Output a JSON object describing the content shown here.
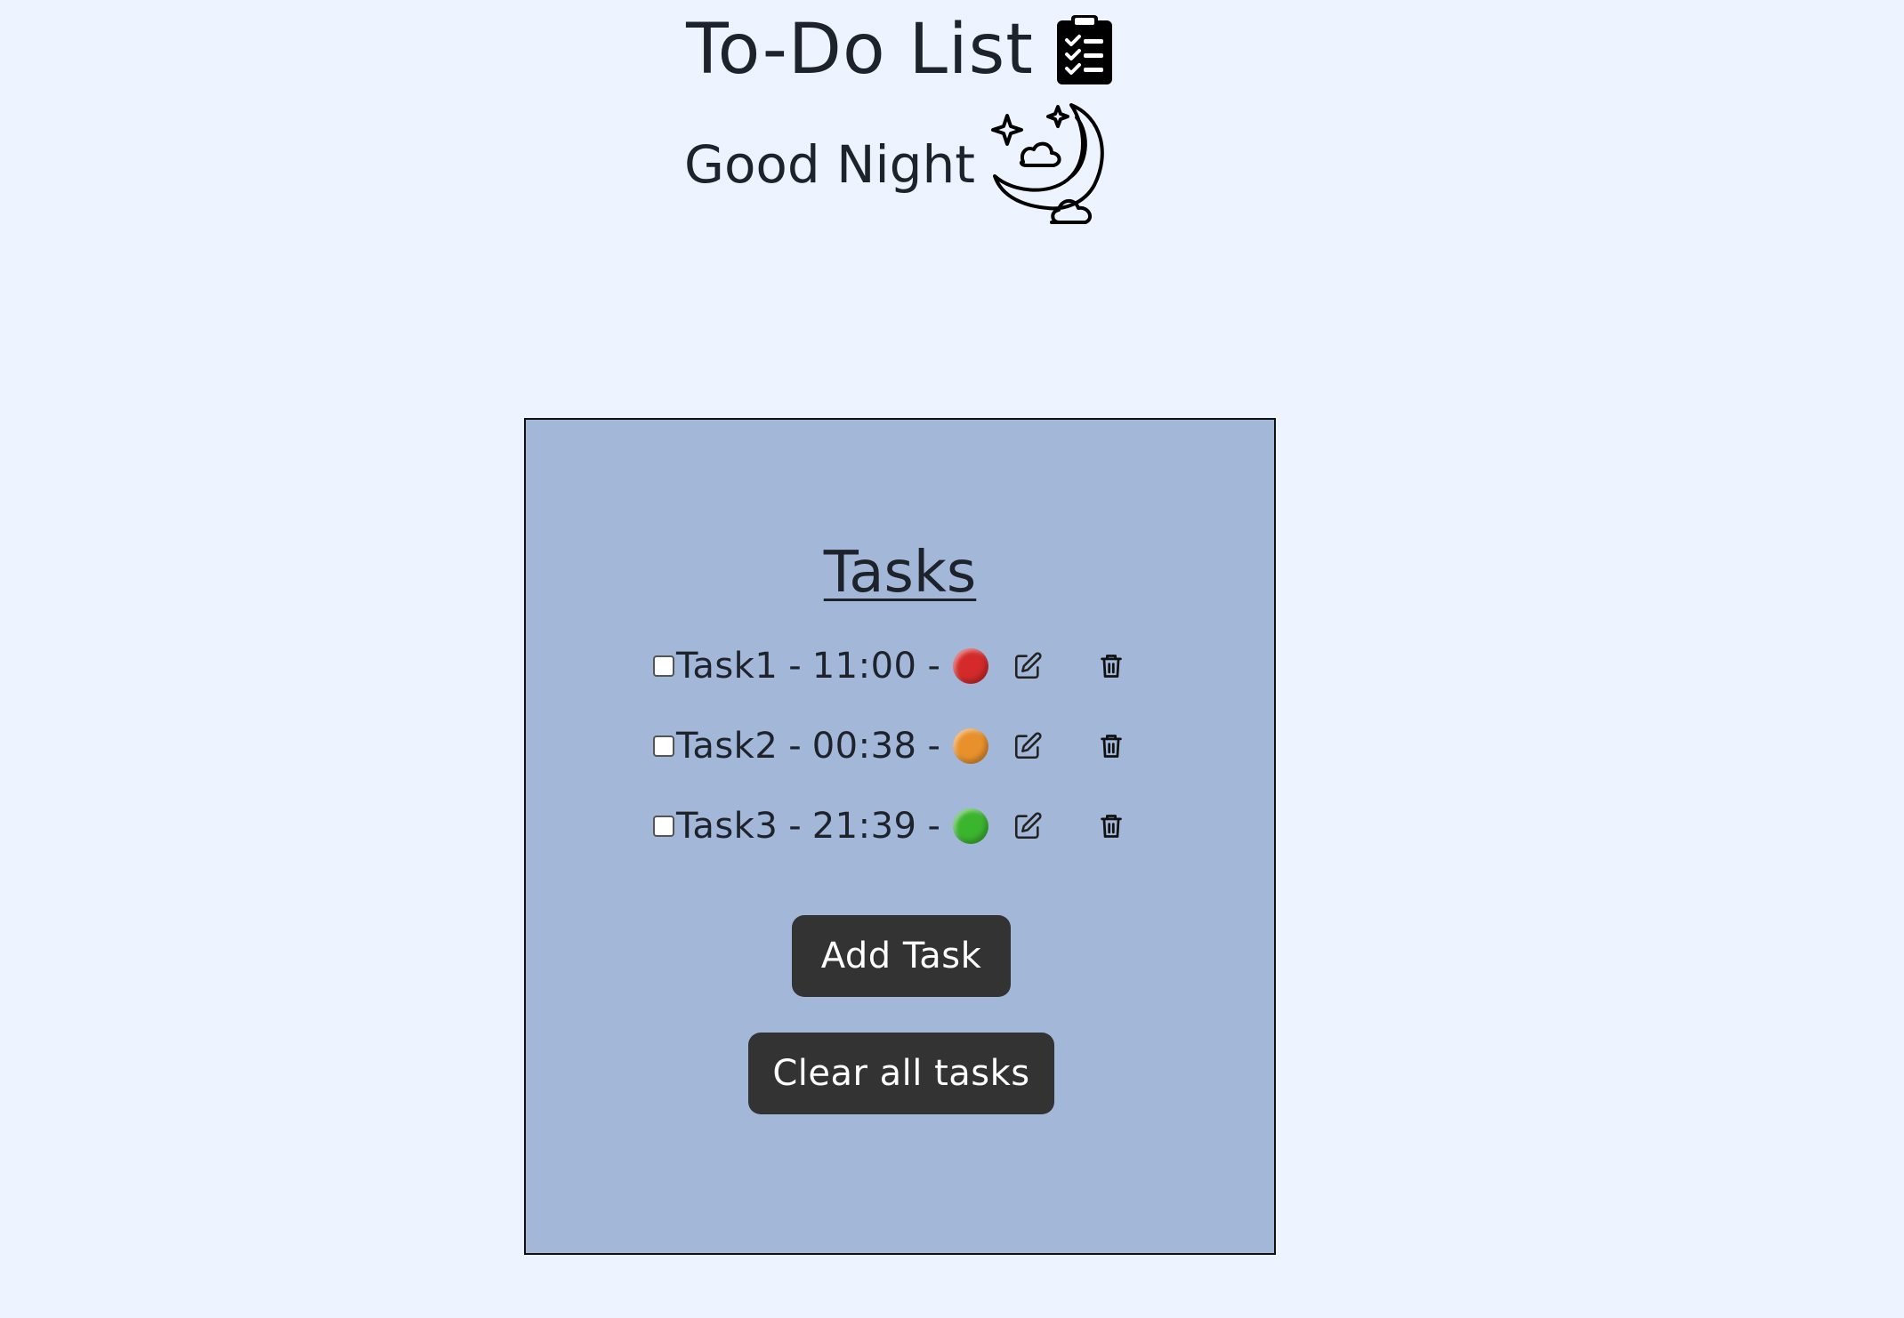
{
  "header": {
    "title": "To-Do List",
    "title_icon": "clipboard-checklist-icon",
    "greeting": "Good Night",
    "greeting_icon": "moon-stars-clouds-icon"
  },
  "panel": {
    "heading": "Tasks",
    "background": "#a3b7d8",
    "tasks": [
      {
        "name": "Task1",
        "separator": "-",
        "time": "11:00",
        "priority_color": "#d42a2a",
        "checked": false
      },
      {
        "name": "Task2",
        "separator": "-",
        "time": "00:38",
        "priority_color": "#e8912c",
        "checked": false
      },
      {
        "name": "Task3",
        "separator": "-",
        "time": "21:39",
        "priority_color": "#3bb52e",
        "checked": false
      }
    ],
    "add_button_label": "Add Task",
    "clear_button_label": "Clear all tasks"
  },
  "colors": {
    "page_background": "#eef4ff",
    "button_background": "#333333",
    "button_text": "#ffffff"
  }
}
